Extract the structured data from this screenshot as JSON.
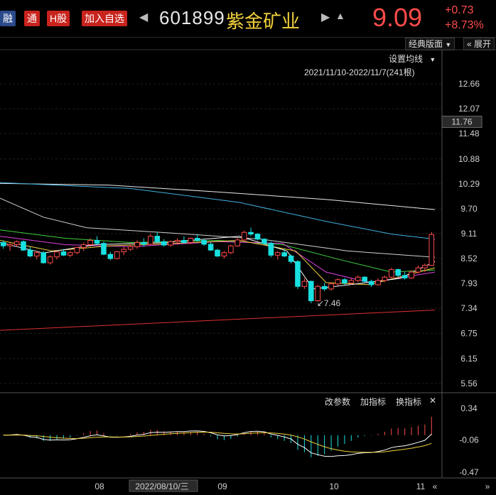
{
  "header": {
    "tags": [
      "融",
      "通",
      "H股",
      "加入自选"
    ],
    "stock_code": "601899",
    "stock_name": "紫金矿业",
    "price": "9.09",
    "change": "+0.73",
    "change_pct": "+8.73%",
    "prev_icon": "triangle-left-icon",
    "next_icon": "triangle-right-icon",
    "bell_icon": "bell-icon"
  },
  "toolbar": {
    "layout_label": "经典版面",
    "expand_label": "展开",
    "ma_setting_label": "设置均线",
    "range_label": "2021/11/10-2022/11/7(241根)"
  },
  "indicator_toolbar": {
    "params_label": "改参数",
    "add_label": "加指标",
    "switch_label": "换指标"
  },
  "colors": {
    "up": "#ff4b4b",
    "down": "#19e0e0",
    "ma5": "#ffffff",
    "ma10": "#f2d23c",
    "ma20": "#e040e0",
    "ma30": "#40d040",
    "ma60": "#d0d0d0",
    "ma120": "#40b0e0",
    "ma250": "#e8e8e8",
    "trend": "#e03030"
  },
  "chart_data": {
    "type": "candlestick",
    "y_ticks": [
      "12.66",
      "12.07",
      "11.48",
      "10.88",
      "10.29",
      "9.70",
      "9.11",
      "8.52",
      "7.93",
      "7.34",
      "6.75",
      "6.15",
      "5.56"
    ],
    "current_marker": "11.76",
    "low_annotation": "7.46",
    "x_labels": [
      "08",
      "2022/08/10/三",
      "09",
      "10",
      "11"
    ],
    "indicator_ticks": [
      "0.34",
      "-0.06",
      "-0.47"
    ],
    "ylim": [
      5.56,
      12.66
    ],
    "candles": [
      [
        8.9,
        8.95,
        8.75,
        8.82
      ],
      [
        8.82,
        8.9,
        8.7,
        8.85
      ],
      [
        8.85,
        8.95,
        8.8,
        8.92
      ],
      [
        8.92,
        8.95,
        8.7,
        8.72
      ],
      [
        8.72,
        8.8,
        8.55,
        8.58
      ],
      [
        8.58,
        8.7,
        8.5,
        8.66
      ],
      [
        8.66,
        8.7,
        8.4,
        8.42
      ],
      [
        8.42,
        8.6,
        8.38,
        8.56
      ],
      [
        8.56,
        8.7,
        8.5,
        8.68
      ],
      [
        8.68,
        8.75,
        8.58,
        8.6
      ],
      [
        8.6,
        8.7,
        8.55,
        8.66
      ],
      [
        8.66,
        8.8,
        8.62,
        8.78
      ],
      [
        8.78,
        8.9,
        8.7,
        8.85
      ],
      [
        8.85,
        9.0,
        8.8,
        8.95
      ],
      [
        8.95,
        9.05,
        8.85,
        8.88
      ],
      [
        8.88,
        8.92,
        8.6,
        8.62
      ],
      [
        8.62,
        8.68,
        8.48,
        8.52
      ],
      [
        8.52,
        8.7,
        8.5,
        8.68
      ],
      [
        8.68,
        8.8,
        8.6,
        8.74
      ],
      [
        8.74,
        8.85,
        8.7,
        8.8
      ],
      [
        8.8,
        8.95,
        8.75,
        8.9
      ],
      [
        8.9,
        9.0,
        8.8,
        8.86
      ],
      [
        8.86,
        9.1,
        8.84,
        9.05
      ],
      [
        9.05,
        9.15,
        8.9,
        8.92
      ],
      [
        8.92,
        8.98,
        8.8,
        8.84
      ],
      [
        8.84,
        8.95,
        8.8,
        8.92
      ],
      [
        8.92,
        9.0,
        8.85,
        8.95
      ],
      [
        8.95,
        9.05,
        8.88,
        8.9
      ],
      [
        8.9,
        9.02,
        8.86,
        9.0
      ],
      [
        9.0,
        9.1,
        8.92,
        8.95
      ],
      [
        8.95,
        9.0,
        8.82,
        8.86
      ],
      [
        8.86,
        8.9,
        8.7,
        8.72
      ],
      [
        8.72,
        8.75,
        8.55,
        8.58
      ],
      [
        8.58,
        8.7,
        8.52,
        8.66
      ],
      [
        8.66,
        8.85,
        8.62,
        8.82
      ],
      [
        8.82,
        9.0,
        8.8,
        8.96
      ],
      [
        8.96,
        9.18,
        8.94,
        9.14
      ],
      [
        9.14,
        9.25,
        9.05,
        9.1
      ],
      [
        9.1,
        9.12,
        8.95,
        8.98
      ],
      [
        8.98,
        9.0,
        8.85,
        8.88
      ],
      [
        8.88,
        8.92,
        8.55,
        8.6
      ],
      [
        8.6,
        8.7,
        8.5,
        8.66
      ],
      [
        8.66,
        8.74,
        8.55,
        8.58
      ],
      [
        8.58,
        8.62,
        8.4,
        8.45
      ],
      [
        8.45,
        8.48,
        7.8,
        7.86
      ],
      [
        7.86,
        8.05,
        7.8,
        7.98
      ],
      [
        7.98,
        8.0,
        7.46,
        7.52
      ],
      [
        7.52,
        7.9,
        7.5,
        7.86
      ],
      [
        7.86,
        7.95,
        7.75,
        7.8
      ],
      [
        7.8,
        7.95,
        7.76,
        7.92
      ],
      [
        7.92,
        8.05,
        7.88,
        8.02
      ],
      [
        8.02,
        8.06,
        7.9,
        7.94
      ],
      [
        7.94,
        8.05,
        7.9,
        8.0
      ],
      [
        8.0,
        8.12,
        7.96,
        8.08
      ],
      [
        8.08,
        8.1,
        7.94,
        7.98
      ],
      [
        7.98,
        8.02,
        7.85,
        7.9
      ],
      [
        7.9,
        8.05,
        7.88,
        8.0
      ],
      [
        8.0,
        8.12,
        7.96,
        8.08
      ],
      [
        8.08,
        8.3,
        8.05,
        8.26
      ],
      [
        8.26,
        8.28,
        8.08,
        8.12
      ],
      [
        8.12,
        8.2,
        8.02,
        8.06
      ],
      [
        8.06,
        8.24,
        8.04,
        8.2
      ],
      [
        8.2,
        8.36,
        8.16,
        8.3
      ],
      [
        8.3,
        8.4,
        8.2,
        8.36
      ],
      [
        8.36,
        9.15,
        8.36,
        9.09
      ]
    ],
    "ma_series": [
      {
        "key": "ma250",
        "points": [
          [
            0,
            10.3
          ],
          [
            0.25,
            10.26
          ],
          [
            0.5,
            10.1
          ],
          [
            0.75,
            9.92
          ],
          [
            1.0,
            9.68
          ]
        ]
      },
      {
        "key": "ma120",
        "points": [
          [
            0,
            10.32
          ],
          [
            0.3,
            10.18
          ],
          [
            0.55,
            9.85
          ],
          [
            0.75,
            9.4
          ],
          [
            0.9,
            9.1
          ],
          [
            1.0,
            8.98
          ]
        ]
      },
      {
        "key": "ma60",
        "points": [
          [
            0,
            9.95
          ],
          [
            0.1,
            9.5
          ],
          [
            0.2,
            9.25
          ],
          [
            0.4,
            9.12
          ],
          [
            0.6,
            8.98
          ],
          [
            0.8,
            8.7
          ],
          [
            1.0,
            8.55
          ]
        ]
      },
      {
        "key": "ma30",
        "points": [
          [
            0,
            9.2
          ],
          [
            0.15,
            9.0
          ],
          [
            0.3,
            8.9
          ],
          [
            0.5,
            8.95
          ],
          [
            0.65,
            8.85
          ],
          [
            0.78,
            8.5
          ],
          [
            0.9,
            8.2
          ],
          [
            1.0,
            8.25
          ]
        ]
      },
      {
        "key": "ma20",
        "points": [
          [
            0,
            9.05
          ],
          [
            0.15,
            8.85
          ],
          [
            0.3,
            8.8
          ],
          [
            0.5,
            8.92
          ],
          [
            0.65,
            8.88
          ],
          [
            0.75,
            8.2
          ],
          [
            0.85,
            7.95
          ],
          [
            1.0,
            8.2
          ]
        ]
      },
      {
        "key": "ma10",
        "points": [
          [
            0,
            8.95
          ],
          [
            0.12,
            8.7
          ],
          [
            0.25,
            8.82
          ],
          [
            0.4,
            8.88
          ],
          [
            0.55,
            8.95
          ],
          [
            0.68,
            8.7
          ],
          [
            0.75,
            7.95
          ],
          [
            0.85,
            7.9
          ],
          [
            1.0,
            8.3
          ]
        ]
      },
      {
        "key": "ma5",
        "points": [
          [
            0,
            8.9
          ],
          [
            0.1,
            8.65
          ],
          [
            0.22,
            8.85
          ],
          [
            0.38,
            8.9
          ],
          [
            0.55,
            9.05
          ],
          [
            0.66,
            8.7
          ],
          [
            0.72,
            7.8
          ],
          [
            0.82,
            7.92
          ],
          [
            0.92,
            8.05
          ],
          [
            1.0,
            8.45
          ]
        ]
      }
    ],
    "trend_line": {
      "points": [
        [
          0,
          6.82
        ],
        [
          1.0,
          7.3
        ]
      ]
    }
  }
}
